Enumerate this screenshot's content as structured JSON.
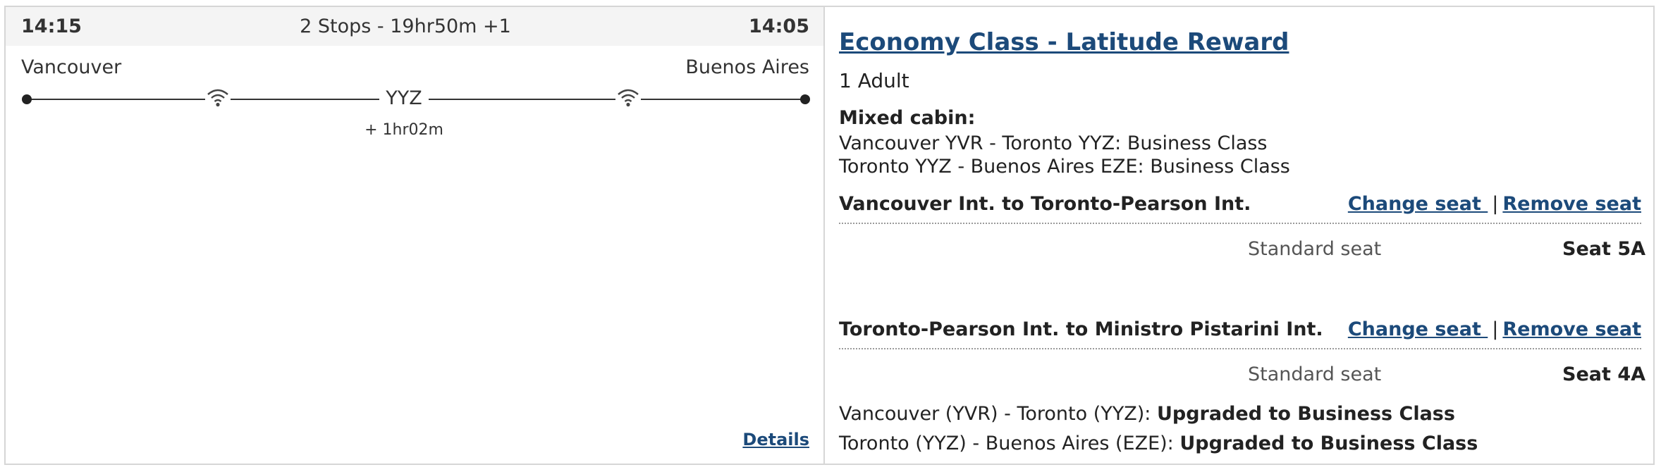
{
  "itinerary": {
    "depart_time": "14:15",
    "summary": "2 Stops - 19hr50m +1",
    "arrive_time": "14:05",
    "origin_city": "Vancouver",
    "destination_city": "Buenos Aires",
    "stop_code": "YYZ",
    "layover": "+ 1hr02m",
    "details_label": "Details",
    "wifi_icons": [
      "wifi-icon",
      "wifi-icon"
    ]
  },
  "fare": {
    "title": "Economy Class - Latitude Reward",
    "passengers": "1 Adult",
    "mixed_label": "Mixed cabin:",
    "cabin_lines": [
      "Vancouver YVR - Toronto YYZ: Business Class",
      "Toronto YYZ - Buenos Aires EZE: Business Class"
    ]
  },
  "segments": [
    {
      "title": "Vancouver Int. to Toronto-Pearson Int.",
      "change_label": "Change seat ",
      "remove_label": "Remove seat",
      "separator": "|",
      "seat_type": "Standard seat",
      "seat": "Seat 5A"
    },
    {
      "title": "Toronto-Pearson Int. to Ministro Pistarini Int.",
      "change_label": "Change seat ",
      "remove_label": "Remove seat",
      "separator": "|",
      "seat_type": "Standard seat",
      "seat": "Seat 4A"
    }
  ],
  "upgrades": [
    {
      "route": "Vancouver  (YVR) - Toronto (YYZ): ",
      "status": "Upgraded to Business Class"
    },
    {
      "route": "Toronto  (YYZ) - Buenos Aires (EZE): ",
      "status": "Upgraded to Business Class"
    }
  ],
  "colors": {
    "link": "#1c4a7a",
    "header_bg": "#f4f4f4",
    "border": "#d6d6d6"
  }
}
